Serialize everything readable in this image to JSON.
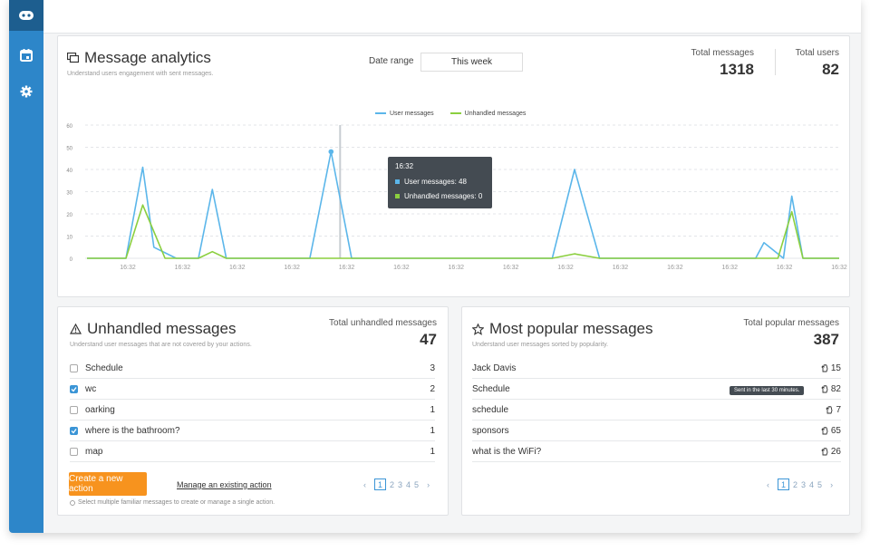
{
  "sidebar": {
    "items": [
      {
        "icon": "bot-icon",
        "active": true
      },
      {
        "icon": "calendar-icon",
        "active": false
      },
      {
        "icon": "gear-icon",
        "active": false
      }
    ]
  },
  "analytics": {
    "title": "Message analytics",
    "subtitle": "Understand users engagement with sent messages.",
    "date_range_label": "Date range",
    "date_range_value": "This week",
    "total_messages_label": "Total messages",
    "total_messages_value": "1318",
    "total_users_label": "Total users",
    "total_users_value": "82"
  },
  "chart_data": {
    "type": "line",
    "x": [
      "16:32",
      "16:32",
      "16:32",
      "16:32",
      "16:32",
      "16:32",
      "16:32",
      "16:32",
      "16:32",
      "16:32",
      "16:32",
      "16:32",
      "16:32",
      "16:32"
    ],
    "ylim": [
      0,
      60
    ],
    "yticks": [
      0,
      10,
      20,
      30,
      40,
      50,
      60
    ],
    "grid": true,
    "legend_position": "top-center",
    "series": [
      {
        "name": "User messages",
        "color": "#5bb6ea",
        "points": [
          [
            0,
            0
          ],
          [
            0.7,
            0
          ],
          [
            1.0,
            41
          ],
          [
            1.2,
            5
          ],
          [
            1.6,
            0
          ],
          [
            2.0,
            0
          ],
          [
            2.25,
            31
          ],
          [
            2.5,
            0
          ],
          [
            3.0,
            0
          ],
          [
            4.0,
            0
          ],
          [
            4.38,
            48
          ],
          [
            4.75,
            0
          ],
          [
            5.0,
            0
          ],
          [
            6.0,
            0
          ],
          [
            7.0,
            0
          ],
          [
            8.0,
            0
          ],
          [
            8.35,
            0
          ],
          [
            8.75,
            40
          ],
          [
            9.2,
            0
          ],
          [
            10.0,
            0
          ],
          [
            11.0,
            0
          ],
          [
            12.0,
            0
          ],
          [
            12.15,
            7
          ],
          [
            12.5,
            0
          ],
          [
            12.65,
            28
          ],
          [
            12.85,
            0
          ],
          [
            13.0,
            0
          ],
          [
            13.5,
            0
          ]
        ]
      },
      {
        "name": "Unhandled messages",
        "color": "#8bcf3f",
        "points": [
          [
            0,
            0
          ],
          [
            0.7,
            0
          ],
          [
            1.0,
            24
          ],
          [
            1.4,
            0
          ],
          [
            2.0,
            0
          ],
          [
            2.25,
            3
          ],
          [
            2.5,
            0
          ],
          [
            3.0,
            0
          ],
          [
            4.38,
            0
          ],
          [
            5.0,
            0
          ],
          [
            8.35,
            0
          ],
          [
            8.75,
            2
          ],
          [
            9.2,
            0
          ],
          [
            12.4,
            0
          ],
          [
            12.65,
            21
          ],
          [
            12.85,
            0
          ],
          [
            13.5,
            0
          ]
        ]
      }
    ],
    "tooltip": {
      "title": "16:32",
      "lines": [
        "User messages: 48",
        "Unhandled messages: 0"
      ],
      "x_index": 4.38
    }
  },
  "unhandled": {
    "title": "Unhandled messages",
    "subtitle": "Understand user messages that are not covered by your actions.",
    "total_label": "Total unhandled messages",
    "total_value": "47",
    "rows": [
      {
        "label": "Schedule",
        "count": "3",
        "checked": false
      },
      {
        "label": "wc",
        "count": "2",
        "checked": true
      },
      {
        "label": "oarking",
        "count": "1",
        "checked": false
      },
      {
        "label": "where is the bathroom?",
        "count": "1",
        "checked": true
      },
      {
        "label": "map",
        "count": "1",
        "checked": false
      }
    ],
    "create_button": "Create a new action",
    "manage_link": "Manage an existing action",
    "note": "Select multiple familiar messages to create or manage a single action.",
    "pages": [
      "1",
      "2",
      "3",
      "4",
      "5"
    ]
  },
  "popular": {
    "title": "Most popular messages",
    "subtitle": "Understand user messages sorted by popularity.",
    "total_label": "Total popular messages",
    "total_value": "387",
    "rows": [
      {
        "label": "Jack Davis",
        "count": "15"
      },
      {
        "label": "Schedule",
        "count": "82"
      },
      {
        "label": "schedule",
        "count": "7"
      },
      {
        "label": "sponsors",
        "count": "65"
      },
      {
        "label": "what is the WiFi?",
        "count": "26"
      }
    ],
    "row_tooltip": "Sent in the last 30 minutes.",
    "pages": [
      "1",
      "2",
      "3",
      "4",
      "5"
    ]
  }
}
